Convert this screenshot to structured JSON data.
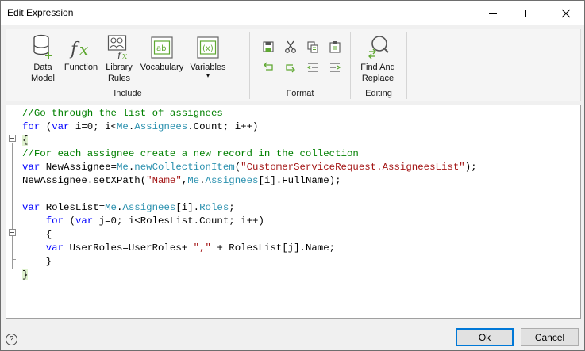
{
  "window": {
    "title": "Edit Expression"
  },
  "ribbon": {
    "include": {
      "label": "Include",
      "buttons": [
        {
          "line1": "Data",
          "line2": "Model",
          "icon": "database-icon"
        },
        {
          "line1": "Function",
          "line2": "",
          "icon": "function-fx-icon"
        },
        {
          "line1": "Library",
          "line2": "Rules",
          "icon": "library-rules-icon"
        },
        {
          "line1": "Vocabulary",
          "line2": "",
          "icon": "vocabulary-icon"
        },
        {
          "line1": "Variables",
          "line2": "▾",
          "icon": "variables-icon"
        }
      ]
    },
    "format": {
      "label": "Format",
      "icons": [
        "save-icon",
        "cut-icon",
        "copy-icon",
        "paste-icon",
        "undo-icon",
        "redo-icon",
        "outdent-icon",
        "indent-icon"
      ]
    },
    "editing": {
      "label": "Editing",
      "button": {
        "line1": "Find And",
        "line2": "Replace",
        "icon": "find-replace-icon"
      }
    }
  },
  "editor": {
    "lines": [
      [
        {
          "t": "//Go through the list of assignees",
          "c": "cm"
        }
      ],
      [
        {
          "t": "for",
          "c": "kw"
        },
        {
          "t": " (",
          "c": ""
        },
        {
          "t": "var",
          "c": "kw"
        },
        {
          "t": " i=0; i<",
          "c": ""
        },
        {
          "t": "Me",
          "c": "ob"
        },
        {
          "t": ".",
          "c": ""
        },
        {
          "t": "Assignees",
          "c": "ob"
        },
        {
          "t": ".Count; i++)",
          "c": ""
        }
      ],
      [
        {
          "t": "{",
          "c": "hl"
        }
      ],
      [
        {
          "t": "//For each assignee create a new record in the collection",
          "c": "cm"
        }
      ],
      [
        {
          "t": "var",
          "c": "kw"
        },
        {
          "t": " NewAssignee=",
          "c": ""
        },
        {
          "t": "Me",
          "c": "ob"
        },
        {
          "t": ".",
          "c": ""
        },
        {
          "t": "newCollectionItem",
          "c": "ob"
        },
        {
          "t": "(",
          "c": ""
        },
        {
          "t": "\"CustomerServiceRequest.AssigneesList\"",
          "c": "st"
        },
        {
          "t": ");",
          "c": ""
        }
      ],
      [
        {
          "t": "NewAssignee.setXPath(",
          "c": ""
        },
        {
          "t": "\"Name\"",
          "c": "st"
        },
        {
          "t": ",",
          "c": ""
        },
        {
          "t": "Me",
          "c": "ob"
        },
        {
          "t": ".",
          "c": ""
        },
        {
          "t": "Assignees",
          "c": "ob"
        },
        {
          "t": "[i].FullName);",
          "c": ""
        }
      ],
      [
        {
          "t": "",
          "c": ""
        }
      ],
      [
        {
          "t": "var",
          "c": "kw"
        },
        {
          "t": " RolesList=",
          "c": ""
        },
        {
          "t": "Me",
          "c": "ob"
        },
        {
          "t": ".",
          "c": ""
        },
        {
          "t": "Assignees",
          "c": "ob"
        },
        {
          "t": "[i].",
          "c": ""
        },
        {
          "t": "Roles",
          "c": "ob"
        },
        {
          "t": ";",
          "c": ""
        }
      ],
      [
        {
          "t": "    ",
          "c": ""
        },
        {
          "t": "for",
          "c": "kw"
        },
        {
          "t": " (",
          "c": ""
        },
        {
          "t": "var",
          "c": "kw"
        },
        {
          "t": " j=0; i<RolesList.Count; i++)",
          "c": ""
        }
      ],
      [
        {
          "t": "    {",
          "c": ""
        }
      ],
      [
        {
          "t": "    ",
          "c": ""
        },
        {
          "t": "var",
          "c": "kw"
        },
        {
          "t": " UserRoles=UserRoles+ ",
          "c": ""
        },
        {
          "t": "\",\"",
          "c": "st"
        },
        {
          "t": " + RolesList[j].Name;",
          "c": ""
        }
      ],
      [
        {
          "t": "    }",
          "c": ""
        }
      ],
      [
        {
          "t": "}",
          "c": "hl"
        }
      ]
    ]
  },
  "footer": {
    "help": "?",
    "ok": "Ok",
    "cancel": "Cancel"
  }
}
